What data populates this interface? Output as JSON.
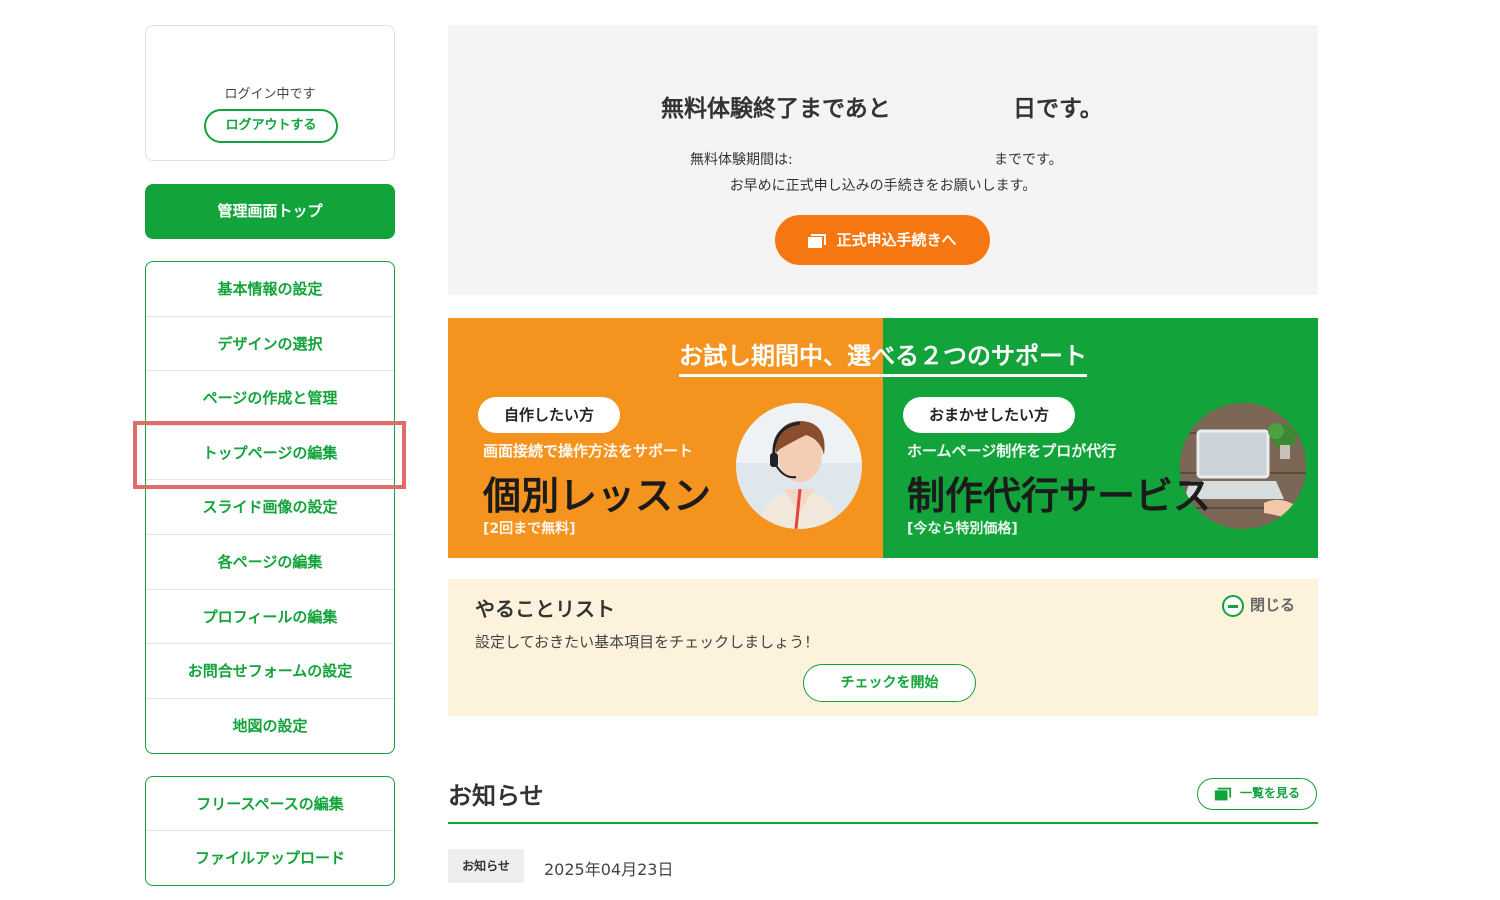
{
  "sidebar": {
    "login_status": "ログイン中です",
    "logout_label": "ログアウトする",
    "admin_top_label": "管理画面トップ",
    "menu_group_1": [
      {
        "label": "基本情報の設定"
      },
      {
        "label": "デザインの選択"
      },
      {
        "label": "ページの作成と管理"
      },
      {
        "label": "トップページの編集"
      },
      {
        "label": "スライド画像の設定"
      },
      {
        "label": "各ページの編集"
      },
      {
        "label": "プロフィールの編集"
      },
      {
        "label": "お問合せフォームの設定"
      },
      {
        "label": "地図の設定"
      }
    ],
    "menu_group_2": [
      {
        "label": "フリースペースの編集"
      },
      {
        "label": "ファイルアップロード"
      }
    ],
    "highlighted_item": "トップページの編集"
  },
  "trial": {
    "headline_prefix": "無料体験終了まであと",
    "headline_suffix": "日です。",
    "period_prefix": "無料体験期間は:",
    "period_suffix": "までです。",
    "notice": "お早めに正式申し込みの手続きをお願いします。",
    "apply_button": "正式申込手続きへ"
  },
  "support_banner": {
    "title": "お試し期間中、選べる２つのサポート",
    "left": {
      "tag": "自作したい方",
      "subtitle": "画面接続で操作方法をサポート",
      "headline": "個別レッスン",
      "note": "[2回まで無料]"
    },
    "right": {
      "tag": "おまかせしたい方",
      "subtitle": "ホームページ制作をプロが代行",
      "headline": "制作代行サービス",
      "note": "[今なら特別価格]"
    }
  },
  "todo": {
    "title": "やることリスト",
    "description": "設定しておきたい基本項目をチェックしましょう！",
    "close_label": "閉じる",
    "check_button": "チェックを開始"
  },
  "news": {
    "title": "お知らせ",
    "view_all": "一覧を見る",
    "items": [
      {
        "tag": "お知らせ",
        "date": "2025年04月23日"
      }
    ]
  },
  "colors": {
    "brand_green": "#12a33a",
    "accent_orange": "#f6770f",
    "banner_orange": "#f5931f",
    "highlight_red": "#e06b6b"
  }
}
